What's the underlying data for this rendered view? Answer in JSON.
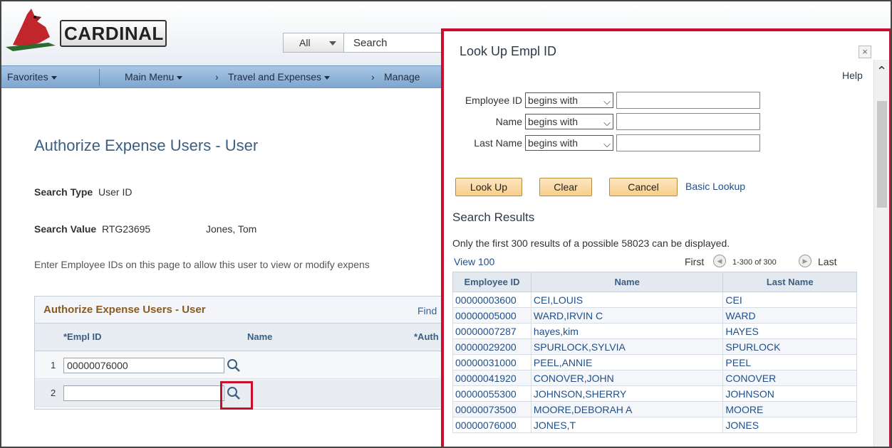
{
  "header": {
    "logo_text": "CARDINAL",
    "search_scope": "All",
    "search_placeholder": "Search"
  },
  "nav": {
    "favorites": "Favorites",
    "main_menu": "Main Menu",
    "breadcrumb_1": "Travel and Expenses",
    "breadcrumb_2": "Manage"
  },
  "page": {
    "title": "Authorize Expense Users - User",
    "search_type_label": "Search Type",
    "search_type_value": "User ID",
    "search_value_label": "Search Value",
    "search_value_value": "RTG23695",
    "search_value_name": "Jones, Tom",
    "instructions": "Enter Employee IDs on this page to allow this user to view or modify expens"
  },
  "grid": {
    "title": "Authorize Expense Users - User",
    "find": "Find",
    "col_empl": "*Empl ID",
    "col_name": "Name",
    "col_auth": "*Auth",
    "rows": [
      {
        "num": "1",
        "empl_id": "00000076000"
      },
      {
        "num": "2",
        "empl_id": ""
      }
    ]
  },
  "modal": {
    "title": "Look Up Empl ID",
    "close": "×",
    "help": "Help",
    "criteria": [
      {
        "label": "Employee ID",
        "operator": "begins with"
      },
      {
        "label": "Name",
        "operator": "begins with"
      },
      {
        "label": "Last Name",
        "operator": "begins with"
      }
    ],
    "buttons": {
      "lookup": "Look Up",
      "clear": "Clear",
      "cancel": "Cancel",
      "basic_lookup": "Basic Lookup"
    },
    "results": {
      "title": "Search Results",
      "note": "Only the first 300 results of a possible 58023 can be displayed.",
      "view_100": "View 100",
      "first": "First",
      "range": "1-300 of 300",
      "last": "Last",
      "columns": [
        "Employee ID",
        "Name",
        "Last Name"
      ],
      "rows": [
        [
          "00000003600",
          "CEI,LOUIS",
          "CEI"
        ],
        [
          "00000005000",
          "WARD,IRVIN C",
          "WARD"
        ],
        [
          "00000007287",
          "hayes,kim",
          "HAYES"
        ],
        [
          "00000029200",
          "SPURLOCK,SYLVIA",
          "SPURLOCK"
        ],
        [
          "00000031000",
          "PEEL,ANNIE",
          "PEEL"
        ],
        [
          "00000041920",
          "CONOVER,JOHN",
          "CONOVER"
        ],
        [
          "00000055300",
          "JOHNSON,SHERRY",
          "JOHNSON"
        ],
        [
          "00000073500",
          "MOORE,DEBORAH A",
          "MOORE"
        ],
        [
          "00000076000",
          "JONES,T",
          "JONES"
        ]
      ]
    }
  },
  "colors": {
    "highlight": "#c8102e",
    "link": "#1f4f8a",
    "nav_bg": "#8fb3d9",
    "button_bg": "#f8cf8c"
  }
}
